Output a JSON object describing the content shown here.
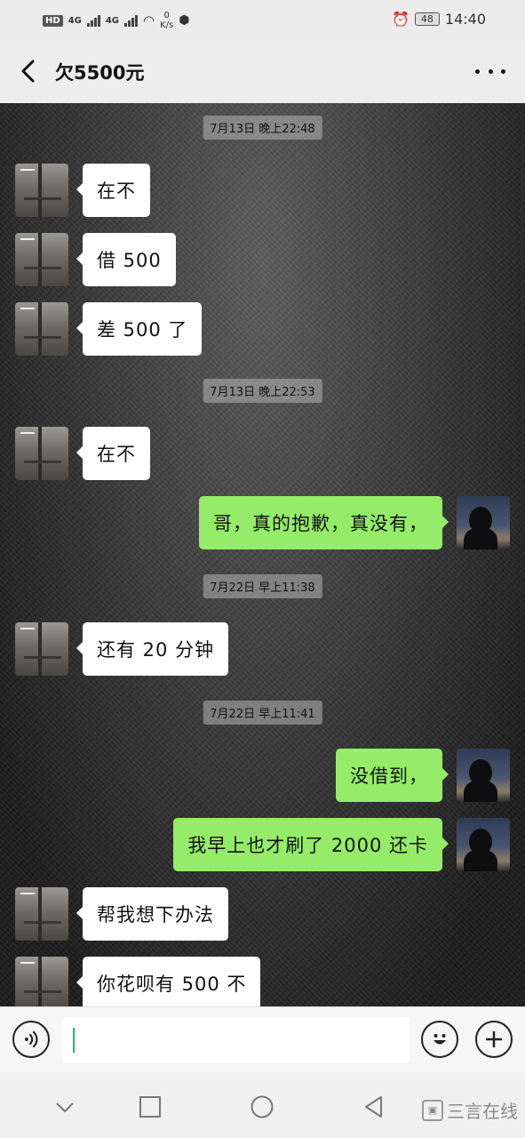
{
  "status_bar": {
    "hd": "HD",
    "net1": "4G",
    "net2": "4G",
    "speed_value": "0",
    "speed_unit": "K/s",
    "battery": "48",
    "time": "14:40"
  },
  "header": {
    "title": "欠5500元"
  },
  "messages": [
    {
      "type": "timestamp",
      "text": "7月13日 晚上22:48"
    },
    {
      "type": "received",
      "text": "在不"
    },
    {
      "type": "received",
      "text": "借 500"
    },
    {
      "type": "received",
      "text": "差 500 了"
    },
    {
      "type": "timestamp",
      "text": "7月13日 晚上22:53"
    },
    {
      "type": "received",
      "text": "在不"
    },
    {
      "type": "sent",
      "text": "哥，真的抱歉，真没有，"
    },
    {
      "type": "timestamp",
      "text": "7月22日 早上11:38"
    },
    {
      "type": "received",
      "text": "还有 20 分钟"
    },
    {
      "type": "timestamp",
      "text": "7月22日 早上11:41"
    },
    {
      "type": "sent",
      "text": "没借到，"
    },
    {
      "type": "sent",
      "text": "我早上也才刷了 2000 还卡"
    },
    {
      "type": "received",
      "text": "帮我想下办法"
    },
    {
      "type": "received",
      "text": "你花呗有 500 不"
    }
  ],
  "input": {
    "value": "",
    "voice_icon": "voice-icon",
    "emoji_icon": "emoji-icon",
    "plus_icon": "plus-icon"
  },
  "watermark": {
    "text": "三言在线"
  },
  "colors": {
    "sent_bubble": "#95ec69",
    "received_bubble": "#ffffff",
    "caret": "#07c160"
  }
}
